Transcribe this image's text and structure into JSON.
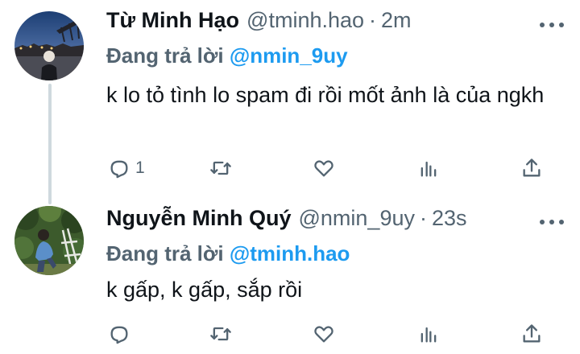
{
  "tweets": [
    {
      "name": "Từ Minh Hạo",
      "handle": "@tminh.hao",
      "separator": "·",
      "time": "2m",
      "reply_label": "Đang trả lời",
      "reply_to": "@nmin_9uy",
      "text": "k lo tỏ tình lo spam đi rồi mốt ảnh là của ngkh",
      "reply_count": "1"
    },
    {
      "name": "Nguyễn Minh Quý",
      "handle": "@nmin_9uy",
      "separator": "·",
      "time": "23s",
      "reply_label": "Đang trả lời",
      "reply_to": "@tminh.hao",
      "text": "k gấp, k gấp, sắp rồi",
      "reply_count": ""
    }
  ],
  "icons": {
    "reply": "reply-icon",
    "retweet": "retweet-icon",
    "like": "heart-icon",
    "stats": "stats-icon",
    "share": "share-icon",
    "more": "more-icon"
  },
  "colors": {
    "accent": "#1d9bf0",
    "secondary_text": "#536471",
    "primary_text": "#0f1419",
    "thread_line": "#cfd9de"
  }
}
